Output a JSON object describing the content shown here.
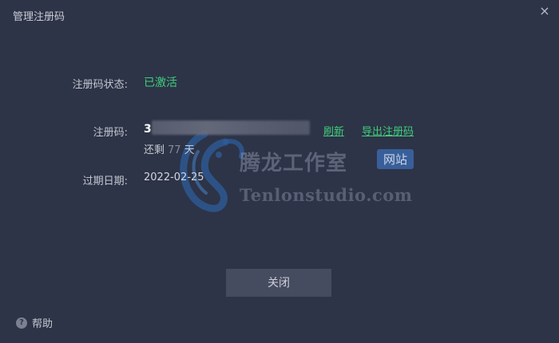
{
  "window": {
    "title": "管理注册码",
    "close_icon": "×"
  },
  "status": {
    "label": "注册码状态:",
    "value": "已激活",
    "color": "#3ecf7a"
  },
  "code": {
    "label": "注册码:",
    "visible_prefix": "3",
    "refresh_link": "刷新",
    "export_link": "导出注册码"
  },
  "remaining": {
    "prefix": "还剩",
    "days": "77",
    "suffix": "天"
  },
  "expiry": {
    "label": "过期日期:",
    "value": "2022-02-25"
  },
  "watermark": {
    "brand": "腾龙工作室",
    "badge": "网站",
    "url": "Tenlonstudio.com",
    "icon": "dragon-logo-icon"
  },
  "footer": {
    "close_button": "关闭",
    "help_label": "帮助",
    "help_icon": "?"
  },
  "colors": {
    "background": "#2e3447",
    "accent": "#3ecf7a",
    "button": "#464c60"
  }
}
